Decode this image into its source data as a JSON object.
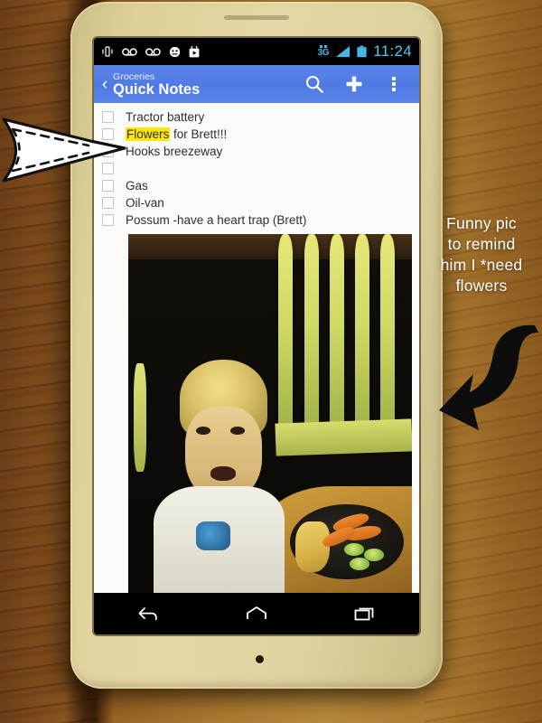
{
  "scene": {
    "description": "Smartphone on a wooden table showing a note-taking app checklist with an attached photo",
    "phone_body_color": "#ddd09a",
    "table_color": "#a97a31"
  },
  "statusbar": {
    "icons": [
      "vibrate-icon",
      "voicemail-icon",
      "voicemail-icon",
      "face-icon",
      "play-store-icon"
    ],
    "network_label": "3G",
    "signal_icon": "signal-bars-icon",
    "battery_icon": "battery-icon",
    "clock": "11:24",
    "accent_color": "#52c7ef"
  },
  "appbar": {
    "back_glyph": "‹",
    "subtitle": "Groceries",
    "title": "Quick Notes",
    "background_color": "#4f79e3",
    "actions": [
      {
        "name": "search",
        "label": "Search"
      },
      {
        "name": "add",
        "label": "Add"
      },
      {
        "name": "overflow",
        "label": "More options"
      }
    ]
  },
  "checklist": {
    "highlight_color": "#ffe800",
    "items": [
      {
        "text": "Tractor battery",
        "checked": false,
        "highlight": ""
      },
      {
        "text": "Flowers for Brett!!!",
        "checked": false,
        "highlight": "Flowers"
      },
      {
        "text": "Hooks breezeway",
        "checked": false,
        "highlight": ""
      },
      {
        "text": "",
        "checked": false,
        "highlight": ""
      },
      {
        "text": "Gas",
        "checked": false,
        "highlight": ""
      },
      {
        "text": "Oil-van",
        "checked": false,
        "highlight": ""
      },
      {
        "text": "Possum -have a heart trap (Brett)",
        "checked": false,
        "highlight": ""
      }
    ]
  },
  "attachment": {
    "name": "photo-attachment",
    "alt": "Young blond boy making a face at a table with a plate of carrots and cucumbers"
  },
  "navbar": {
    "buttons": [
      {
        "name": "back",
        "label": "Back"
      },
      {
        "name": "home",
        "label": "Home"
      },
      {
        "name": "recents",
        "label": "Recent apps"
      }
    ]
  },
  "annotations": {
    "caption_lines": [
      "Funny pic",
      "to remind",
      "him I *need",
      "flowers"
    ],
    "caption_text": "Funny pic to remind him I *need flowers",
    "left_arrow": "dashed-outline-arrow-right",
    "right_arrow": "curved-arrow-down-left"
  }
}
